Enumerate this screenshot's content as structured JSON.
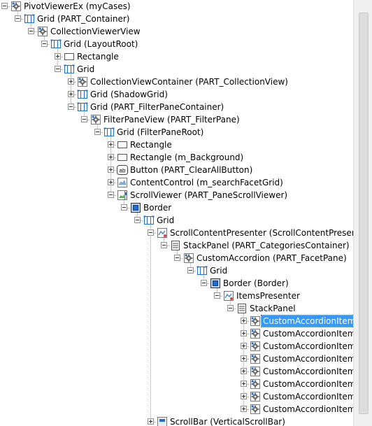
{
  "tree": {
    "nodes": [
      {
        "label": "PivotViewerEx (myCases)",
        "icon": "gear",
        "expander": "minus",
        "depth": 0
      },
      {
        "label": "Grid (PART_Container)",
        "icon": "grid",
        "expander": "minus",
        "depth": 1
      },
      {
        "label": "CollectionViewerView",
        "icon": "gear",
        "expander": "minus",
        "depth": 2
      },
      {
        "label": "Grid (LayoutRoot)",
        "icon": "grid",
        "expander": "minus",
        "depth": 3
      },
      {
        "label": "Rectangle",
        "icon": "rect",
        "expander": "plus",
        "depth": 4
      },
      {
        "label": "Grid",
        "icon": "grid",
        "expander": "minus",
        "depth": 4
      },
      {
        "label": "CollectionViewContainer (PART_CollectionView)",
        "icon": "gear",
        "expander": "plus",
        "depth": 5
      },
      {
        "label": "Grid (ShadowGrid)",
        "icon": "grid",
        "expander": "plus",
        "depth": 5
      },
      {
        "label": "Grid (PART_FilterPaneContainer)",
        "icon": "grid",
        "expander": "minus",
        "depth": 5
      },
      {
        "label": "FilterPaneView (PART_FilterPane)",
        "icon": "gear",
        "expander": "minus",
        "depth": 6
      },
      {
        "label": "Grid (FilterPaneRoot)",
        "icon": "grid",
        "expander": "minus",
        "depth": 7
      },
      {
        "label": "Rectangle",
        "icon": "rect",
        "expander": "plus",
        "depth": 8
      },
      {
        "label": "Rectangle (m_Background)",
        "icon": "rect",
        "expander": "plus",
        "depth": 8
      },
      {
        "label": "Button (PART_ClearAllButton)",
        "icon": "button",
        "expander": "plus",
        "depth": 8
      },
      {
        "label": "ContentControl (m_searchFacetGrid)",
        "icon": "content",
        "expander": "plus",
        "depth": 8
      },
      {
        "label": "ScrollViewer (PART_PaneScrollViewer)",
        "icon": "scrollviewer",
        "expander": "minus",
        "depth": 8
      },
      {
        "label": "Border",
        "icon": "border",
        "expander": "minus",
        "depth": 9
      },
      {
        "label": "Grid",
        "icon": "grid",
        "expander": "minus",
        "depth": 10
      },
      {
        "label": "ScrollContentPresenter (ScrollContentPresenter)",
        "icon": "presenter",
        "expander": "minus",
        "depth": 11
      },
      {
        "label": "StackPanel (PART_CategoriesContainer)",
        "icon": "stack",
        "expander": "minus",
        "depth": 12
      },
      {
        "label": "CustomAccordion (PART_FacetPane)",
        "icon": "gear",
        "expander": "minus",
        "depth": 13
      },
      {
        "label": "Grid",
        "icon": "grid",
        "expander": "minus",
        "depth": 14
      },
      {
        "label": "Border (Border)",
        "icon": "border",
        "expander": "minus",
        "depth": 15
      },
      {
        "label": "ItemsPresenter",
        "icon": "presenter",
        "expander": "minus",
        "depth": 16
      },
      {
        "label": "StackPanel",
        "icon": "stack",
        "expander": "minus",
        "depth": 17
      },
      {
        "label": "CustomAccordionItem",
        "icon": "gear",
        "expander": "plus",
        "depth": 18,
        "selected": true
      },
      {
        "label": "CustomAccordionItem",
        "icon": "gear",
        "expander": "plus",
        "depth": 18
      },
      {
        "label": "CustomAccordionItem",
        "icon": "gear",
        "expander": "plus",
        "depth": 18
      },
      {
        "label": "CustomAccordionItem",
        "icon": "gear",
        "expander": "plus",
        "depth": 18
      },
      {
        "label": "CustomAccordionItem",
        "icon": "gear",
        "expander": "plus",
        "depth": 18
      },
      {
        "label": "CustomAccordionItem",
        "icon": "gear",
        "expander": "plus",
        "depth": 18
      },
      {
        "label": "CustomAccordionItem",
        "icon": "gear",
        "expander": "plus",
        "depth": 18
      },
      {
        "label": "CustomAccordionItem",
        "icon": "gear",
        "expander": "plus",
        "depth": 18
      },
      {
        "label": "ScrollBar (VerticalScrollBar)",
        "icon": "scrollbar",
        "expander": "plus",
        "depth": 11
      }
    ]
  },
  "colors": {
    "selection": "#3399ff",
    "selection_text": "#ffffff",
    "tree_line": "#a0a0a0",
    "icon_blue": "#1f6fd1",
    "background": "#ffffff"
  }
}
